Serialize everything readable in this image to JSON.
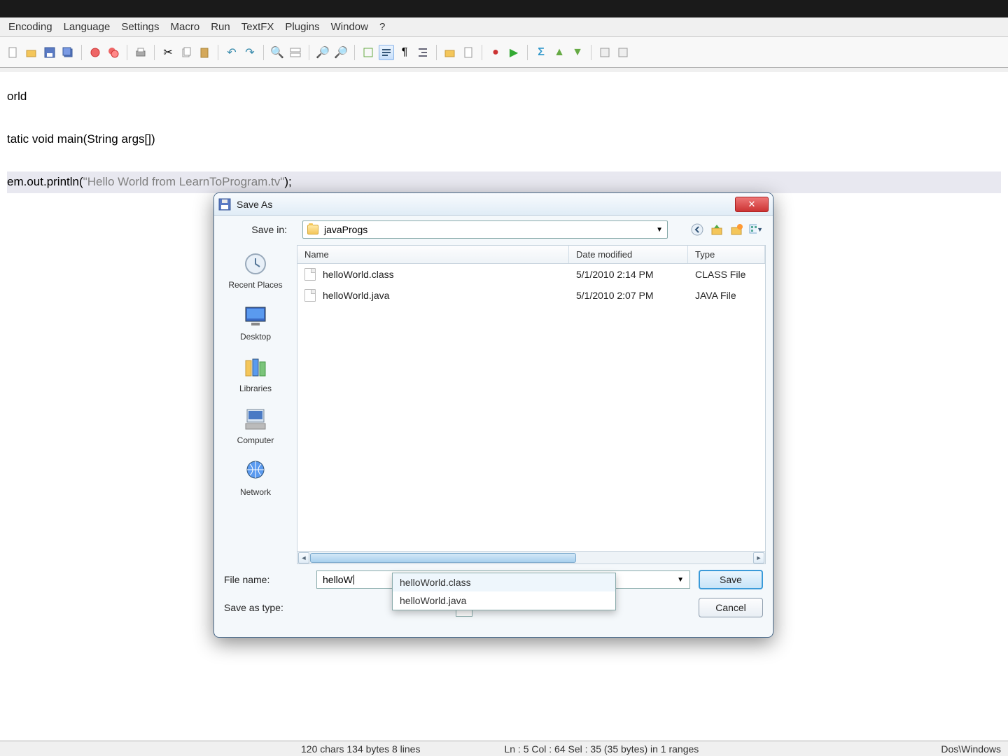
{
  "menu": [
    "Encoding",
    "Language",
    "Settings",
    "Macro",
    "Run",
    "TextFX",
    "Plugins",
    "Window",
    "?"
  ],
  "code": {
    "l1": "orld",
    "l2": "tatic void main(String args[])",
    "l3a": "em.out.println(",
    "l3b": "\"Hello World from LearnToProgram.tv\"",
    "l3c": ");"
  },
  "statusbar": {
    "left": "120 chars  134 bytes  8 lines",
    "mid": "Ln : 5    Col : 64    Sel : 35 (35 bytes) in 1 ranges",
    "right": "Dos\\Windows"
  },
  "dialog": {
    "title": "Save As",
    "savein_label": "Save in:",
    "savein_value": "javaProgs",
    "columns": {
      "name": "Name",
      "date": "Date modified",
      "type": "Type"
    },
    "files": [
      {
        "name": "helloWorld.class",
        "date": "5/1/2010 2:14 PM",
        "type": "CLASS File"
      },
      {
        "name": "helloWorld.java",
        "date": "5/1/2010 2:07 PM",
        "type": "JAVA File"
      }
    ],
    "places": [
      "Recent Places",
      "Desktop",
      "Libraries",
      "Computer",
      "Network"
    ],
    "filename_label": "File name:",
    "filename_value": "helloW",
    "saveastype_label": "Save as type:",
    "save_btn": "Save",
    "cancel_btn": "Cancel",
    "autocomplete": [
      "helloWorld.class",
      "helloWorld.java"
    ]
  }
}
